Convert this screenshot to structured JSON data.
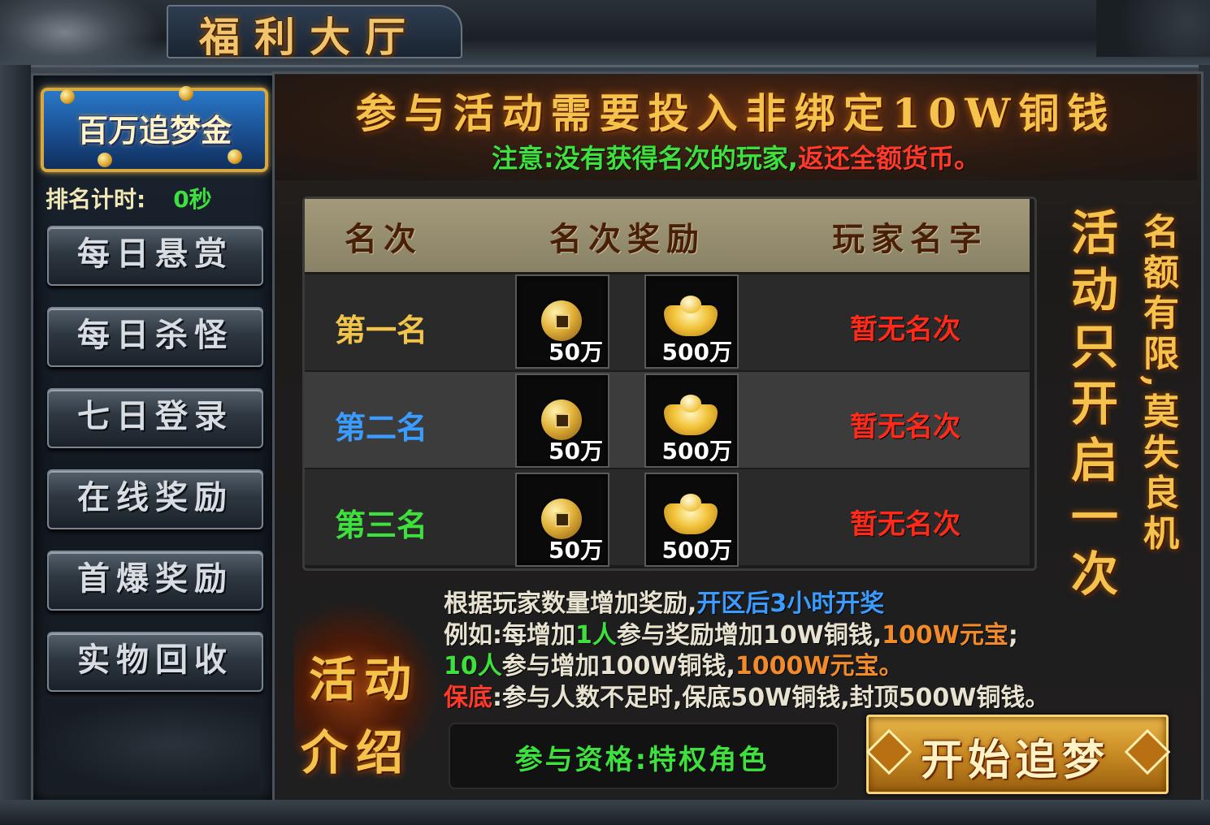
{
  "window": {
    "title": "福利大厅"
  },
  "sidebar": {
    "banner_label": "百万追梦金",
    "timer_label": "排名计时:",
    "timer_value": "0秒",
    "items": [
      {
        "label": "每日悬赏"
      },
      {
        "label": "每日杀怪"
      },
      {
        "label": "七日登录"
      },
      {
        "label": "在线奖励"
      },
      {
        "label": "首爆奖励"
      },
      {
        "label": "实物回收"
      }
    ]
  },
  "main": {
    "headline": "参与活动需要投入非绑定10W铜钱",
    "note_prefix": "注意:没有获得名次的玩家,",
    "note_suffix": "返还全额货币。",
    "table": {
      "headers": [
        "名次",
        "名次奖励",
        "玩家名字"
      ],
      "rows": [
        {
          "rank": "第一名",
          "rank_color": "#f2c44a",
          "rewards": [
            {
              "icon": "copper-coin-icon",
              "qty": "50万"
            },
            {
              "icon": "gold-ingot-icon",
              "qty": "500万"
            }
          ],
          "player": "暂无名次"
        },
        {
          "rank": "第二名",
          "rank_color": "#3a9cff",
          "rewards": [
            {
              "icon": "copper-coin-icon",
              "qty": "50万"
            },
            {
              "icon": "gold-ingot-icon",
              "qty": "500万"
            }
          ],
          "player": "暂无名次"
        },
        {
          "rank": "第三名",
          "rank_color": "#3ee03e",
          "rewards": [
            {
              "icon": "copper-coin-icon",
              "qty": "50万"
            },
            {
              "icon": "gold-ingot-icon",
              "qty": "500万"
            }
          ],
          "player": "暂无名次"
        }
      ]
    },
    "side_text_1": "活动只开启一次",
    "side_text_2": "名额有限,莫失良机",
    "intro": {
      "title_line1": "活动",
      "title_line2": "介绍",
      "line1_a": "根据玩家数量增加奖励,",
      "line1_b": "开区后3小时开奖",
      "line2_a": "例如:每增加",
      "line2_b": "1人",
      "line2_c": "参与奖励增加10W铜钱,",
      "line2_d": "100W元宝",
      "line2_e": ";",
      "line3_a": "10人",
      "line3_b": "参与增加100W铜钱,",
      "line3_c": "1000W元宝。",
      "line4_a": "保底",
      "line4_b": ":参与人数不足时,保底50W铜钱,封顶500W铜钱。"
    },
    "qualification": "参与资格:特权角色",
    "start_button": "开始追梦"
  }
}
